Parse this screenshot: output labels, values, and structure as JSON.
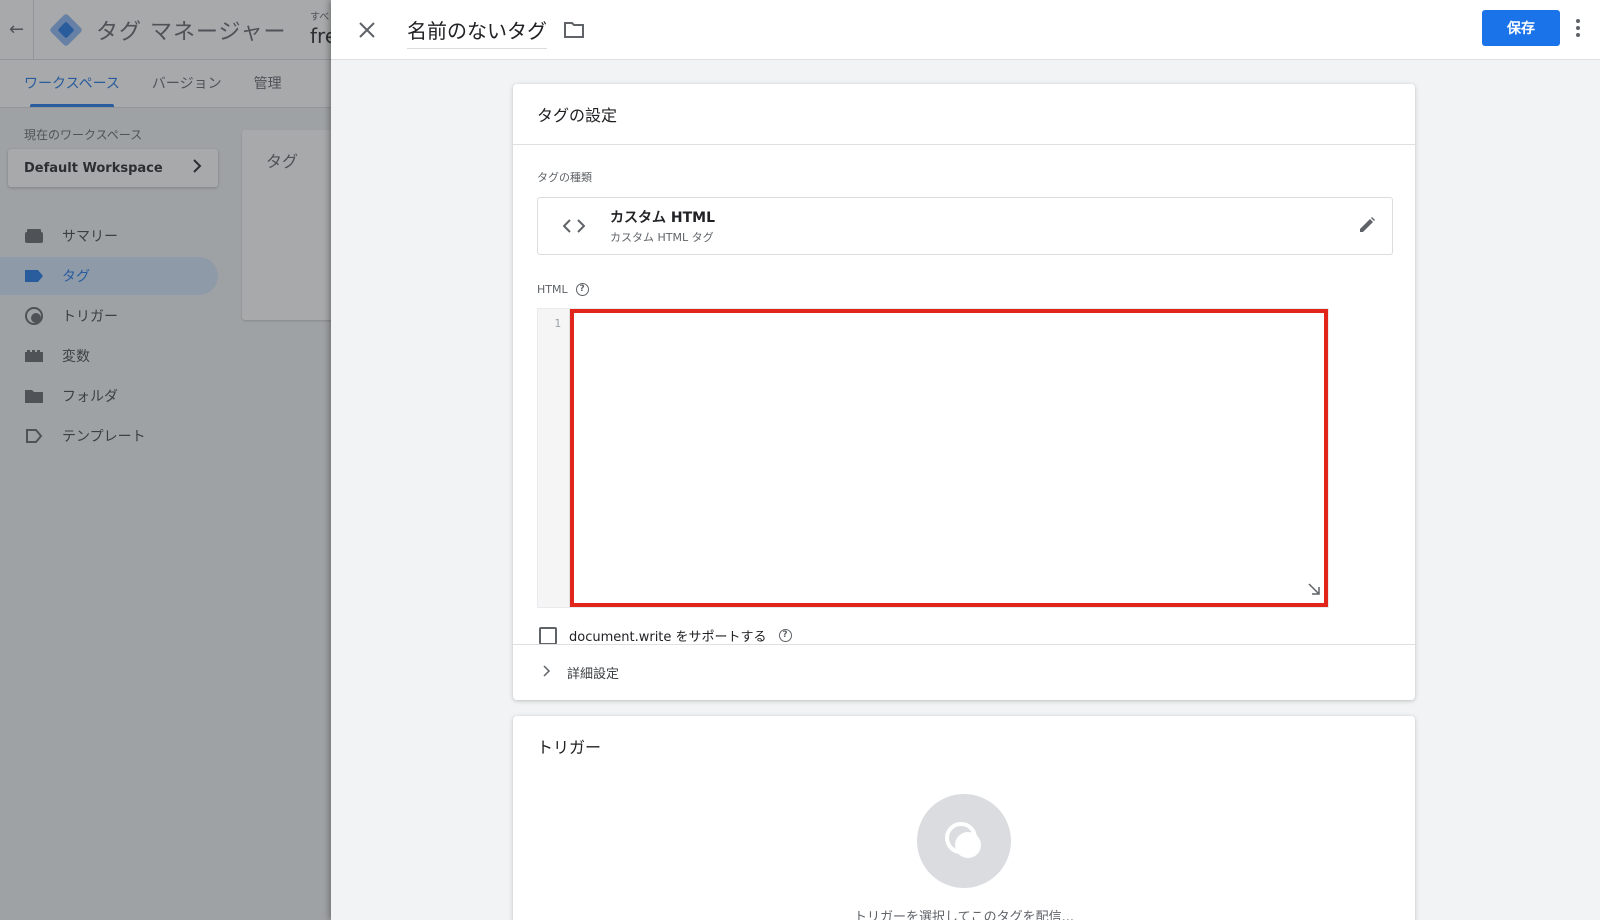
{
  "app": {
    "product_name": "タグ マネージャー",
    "account_prefix": "すべ",
    "account_name": "fre",
    "tabs": [
      {
        "label": "ワークスペース",
        "active": true
      },
      {
        "label": "バージョン",
        "active": false
      },
      {
        "label": "管理",
        "active": false
      }
    ],
    "workspace_label": "現在のワークスペース",
    "workspace_name": "Default Workspace",
    "nav": [
      {
        "label": "サマリー",
        "icon": "summary-icon"
      },
      {
        "label": "タグ",
        "icon": "tag-icon",
        "active": true
      },
      {
        "label": "トリガー",
        "icon": "trigger-icon"
      },
      {
        "label": "変数",
        "icon": "variable-icon"
      },
      {
        "label": "フォルダ",
        "icon": "folder-icon"
      },
      {
        "label": "テンプレート",
        "icon": "template-icon"
      }
    ],
    "card_title": "タグ"
  },
  "panel": {
    "tag_name": "名前のないタグ",
    "save_label": "保存",
    "config": {
      "title": "タグの設定",
      "type_label": "タグの種類",
      "type_title": "カスタム HTML",
      "type_subtitle": "カスタム HTML タグ",
      "html_label": "HTML",
      "line_number": "1",
      "docwrite_label": "document.write をサポートする",
      "advanced_label": "詳細設定"
    },
    "trigger": {
      "title": "トリガー",
      "hint": "トリガーを選択してこのタグを配信..."
    }
  },
  "colors": {
    "accent": "#1a73e8",
    "highlight": "#e1251b"
  }
}
